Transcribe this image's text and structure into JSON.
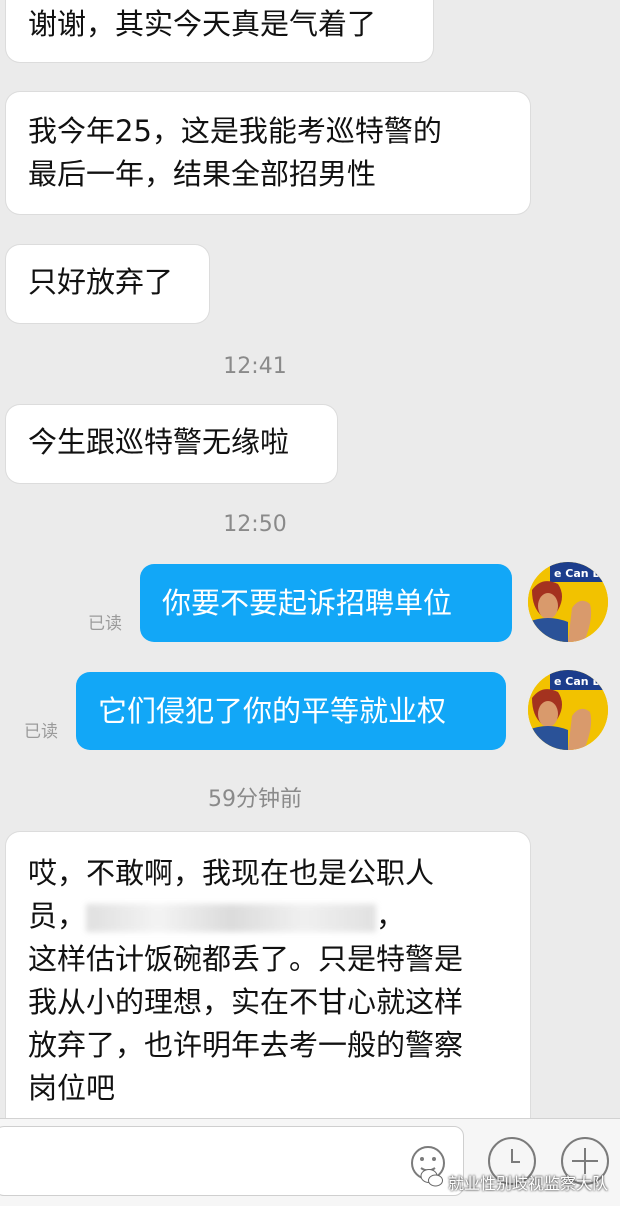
{
  "messages": {
    "m1": "谢谢，其实今天真是气着了",
    "m2_l1": "我今年25，这是我能考巡特警的",
    "m2_l2": "最后一年，结果全部招男性",
    "m3": "只好放弃了",
    "ts1": "12:41",
    "m4": "今生跟巡特警无缘啦",
    "ts2": "12:50",
    "out1": "你要不要起诉招聘单位",
    "out2": "它们侵犯了你的平等就业权",
    "read": "已读",
    "ts3": "59分钟前",
    "m5_l1": "哎，不敢啊，我现在也是公职人",
    "m5_l2a": "员，",
    "m5_l2b": "，",
    "m5_l3": "这样估计饭碗都丢了。只是特警是",
    "m5_l4": "我从小的理想，实在不甘心就这样",
    "m5_l5": "放弃了，也许明年去考一般的警察",
    "m5_l6": "岗位吧"
  },
  "avatar": {
    "caption": "e Can Do It"
  },
  "watermark": "就业性别歧视监察大队",
  "icons": [
    "emoji-icon",
    "clock-icon",
    "plus-icon",
    "wechat-icon"
  ],
  "colors": {
    "outgoing": "#12a7f7",
    "background": "#ebebeb",
    "avatar": "#f2c200"
  }
}
